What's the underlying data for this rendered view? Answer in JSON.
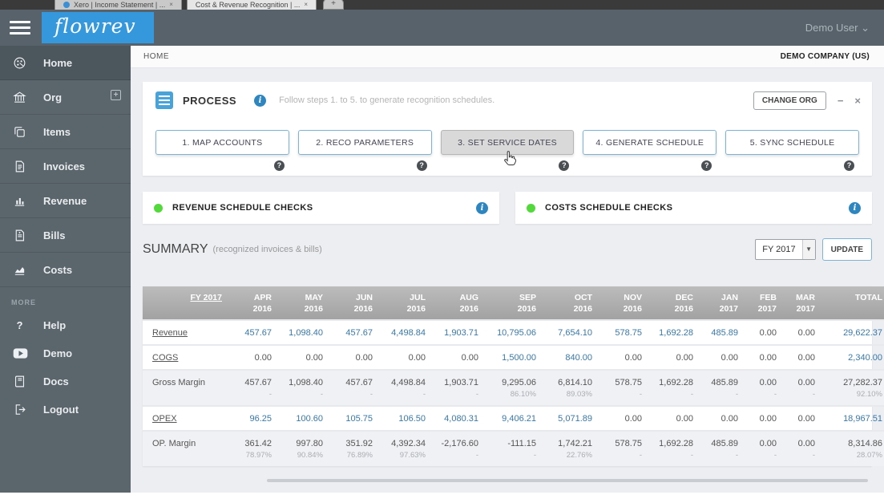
{
  "browser": {
    "tabs": [
      {
        "label": "Xero | Income Statement | ...",
        "close": "×"
      },
      {
        "label": "Cost & Revenue Recognition | ...",
        "close": "×"
      }
    ],
    "new_tab_label": "+"
  },
  "header": {
    "logo": "flowrev",
    "user": "Demo User ⌄"
  },
  "sidebar": {
    "items": [
      {
        "label": "Home",
        "icon": "dashboard-icon",
        "active": true
      },
      {
        "label": "Org",
        "icon": "bank-icon",
        "plus": true
      },
      {
        "label": "Items",
        "icon": "copy-icon"
      },
      {
        "label": "Invoices",
        "icon": "invoice-icon"
      },
      {
        "label": "Revenue",
        "icon": "bar-chart-icon"
      },
      {
        "label": "Bills",
        "icon": "bill-icon"
      },
      {
        "label": "Costs",
        "icon": "area-chart-icon"
      }
    ],
    "more_label": "MORE",
    "more_items": [
      {
        "label": "Help",
        "icon": "question-icon"
      },
      {
        "label": "Demo",
        "icon": "play-icon"
      },
      {
        "label": "Docs",
        "icon": "book-icon"
      },
      {
        "label": "Logout",
        "icon": "logout-icon"
      }
    ]
  },
  "breadcrumb": {
    "left": "HOME",
    "right": "DEMO COMPANY (US)"
  },
  "process": {
    "title": "PROCESS",
    "subtitle": "Follow steps 1. to 5. to generate recognition schedules.",
    "change_org_label": "CHANGE ORG",
    "minimize_label": "−",
    "close_label": "×",
    "steps": [
      "1.  MAP ACCOUNTS",
      "2.  RECO PARAMETERS",
      "3.  SET SERVICE DATES",
      "4.  GENERATE SCHEDULE",
      "5.  SYNC SCHEDULE"
    ],
    "active_step_index": 2,
    "help_glyph": "?"
  },
  "checks": {
    "revenue_title": "REVENUE SCHEDULE CHECKS",
    "costs_title": "COSTS SCHEDULE CHECKS",
    "status_color": "#54d93c"
  },
  "summary": {
    "title": "SUMMARY",
    "subtitle": "(recognized invoices & bills)",
    "period_selected": "FY 2017",
    "update_label": "UPDATE"
  },
  "table": {
    "first_col_header": "FY 2017",
    "columns": [
      {
        "l1": "APR",
        "l2": "2016"
      },
      {
        "l1": "MAY",
        "l2": "2016"
      },
      {
        "l1": "JUN",
        "l2": "2016"
      },
      {
        "l1": "JUL",
        "l2": "2016"
      },
      {
        "l1": "AUG",
        "l2": "2016"
      },
      {
        "l1": "SEP",
        "l2": "2016"
      },
      {
        "l1": "OCT",
        "l2": "2016"
      },
      {
        "l1": "NOV",
        "l2": "2016"
      },
      {
        "l1": "DEC",
        "l2": "2016"
      },
      {
        "l1": "JAN",
        "l2": "2017"
      },
      {
        "l1": "FEB",
        "l2": "2017"
      },
      {
        "l1": "MAR",
        "l2": "2017"
      },
      {
        "l1": "TOTAL",
        "l2": ""
      }
    ],
    "rows": [
      {
        "label": "Revenue",
        "link": true,
        "shaded": false,
        "cells": [
          {
            "v": "457.67",
            "b": true
          },
          {
            "v": "1,098.40",
            "b": true
          },
          {
            "v": "457.67",
            "b": true
          },
          {
            "v": "4,498.84",
            "b": true
          },
          {
            "v": "1,903.71",
            "b": true
          },
          {
            "v": "10,795.06",
            "b": true
          },
          {
            "v": "7,654.10",
            "b": true
          },
          {
            "v": "578.75",
            "b": true
          },
          {
            "v": "1,692.28",
            "b": true
          },
          {
            "v": "485.89",
            "b": true
          },
          {
            "v": "0.00"
          },
          {
            "v": "0.00"
          },
          {
            "v": "29,622.37",
            "b": true
          }
        ]
      },
      {
        "label": "COGS",
        "link": true,
        "shaded": false,
        "cells": [
          {
            "v": "0.00"
          },
          {
            "v": "0.00"
          },
          {
            "v": "0.00"
          },
          {
            "v": "0.00"
          },
          {
            "v": "0.00"
          },
          {
            "v": "1,500.00",
            "b": true
          },
          {
            "v": "840.00",
            "b": true
          },
          {
            "v": "0.00"
          },
          {
            "v": "0.00"
          },
          {
            "v": "0.00"
          },
          {
            "v": "0.00"
          },
          {
            "v": "0.00"
          },
          {
            "v": "2,340.00",
            "b": true
          }
        ]
      },
      {
        "label": "Gross Margin",
        "link": false,
        "shaded": true,
        "cells": [
          {
            "v": "457.67",
            "sub": "-"
          },
          {
            "v": "1,098.40",
            "sub": "-"
          },
          {
            "v": "457.67",
            "sub": "-"
          },
          {
            "v": "4,498.84",
            "sub": "-"
          },
          {
            "v": "1,903.71",
            "sub": "-"
          },
          {
            "v": "9,295.06",
            "sub": "86.10%"
          },
          {
            "v": "6,814.10",
            "sub": "89.03%"
          },
          {
            "v": "578.75",
            "sub": "-"
          },
          {
            "v": "1,692.28",
            "sub": "-"
          },
          {
            "v": "485.89",
            "sub": "-"
          },
          {
            "v": "0.00",
            "sub": "-"
          },
          {
            "v": "0.00",
            "sub": "-"
          },
          {
            "v": "27,282.37",
            "sub": "92.10%"
          }
        ]
      },
      {
        "label": "OPEX",
        "link": true,
        "shaded": false,
        "cells": [
          {
            "v": "96.25",
            "b": true
          },
          {
            "v": "100.60",
            "b": true
          },
          {
            "v": "105.75",
            "b": true
          },
          {
            "v": "106.50",
            "b": true
          },
          {
            "v": "4,080.31",
            "b": true
          },
          {
            "v": "9,406.21",
            "b": true
          },
          {
            "v": "5,071.89",
            "b": true
          },
          {
            "v": "0.00"
          },
          {
            "v": "0.00"
          },
          {
            "v": "0.00"
          },
          {
            "v": "0.00"
          },
          {
            "v": "0.00"
          },
          {
            "v": "18,967.51",
            "b": true
          }
        ]
      },
      {
        "label": "OP. Margin",
        "link": false,
        "shaded": true,
        "cells": [
          {
            "v": "361.42",
            "sub": "78.97%"
          },
          {
            "v": "997.80",
            "sub": "90.84%"
          },
          {
            "v": "351.92",
            "sub": "76.89%"
          },
          {
            "v": "4,392.34",
            "sub": "97.63%"
          },
          {
            "v": "-2,176.60",
            "sub": "-"
          },
          {
            "v": "-111.15",
            "sub": "-"
          },
          {
            "v": "1,742.21",
            "sub": "22.76%"
          },
          {
            "v": "578.75",
            "sub": "-"
          },
          {
            "v": "1,692.28",
            "sub": "-"
          },
          {
            "v": "485.89",
            "sub": "-"
          },
          {
            "v": "0.00",
            "sub": "-"
          },
          {
            "v": "0.00",
            "sub": "-"
          },
          {
            "v": "8,314.86",
            "sub": "28.07%"
          }
        ]
      }
    ]
  },
  "colors": {
    "accent_blue": "#3698dc",
    "link_blue": "#3878a8",
    "header_dark": "#57626a",
    "sidebar_dark": "#5a656c",
    "status_green": "#54d93c",
    "info_blue": "#2e86c1",
    "page_bg": "#eceef2"
  }
}
